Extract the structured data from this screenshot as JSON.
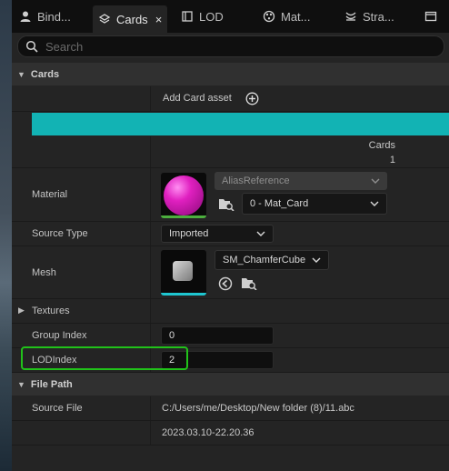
{
  "tabs": [
    {
      "label": "Bind...",
      "icon": "user-icon"
    },
    {
      "label": "Cards",
      "icon": "cards-icon",
      "close": "×"
    },
    {
      "label": "LOD",
      "icon": "lod-icon"
    },
    {
      "label": "Mat...",
      "icon": "material-icon"
    },
    {
      "label": "Stra...",
      "icon": "strand-icon"
    },
    {
      "label": "",
      "icon": "window-icon"
    }
  ],
  "search": {
    "placeholder": "Search"
  },
  "cards_section": {
    "title": "Cards"
  },
  "add_card": {
    "label": "Add Card asset"
  },
  "cards_counter": {
    "label": "Cards",
    "value": "1"
  },
  "material": {
    "label": "Material",
    "alias_reference": "AliasReference",
    "selected": "0 - Mat_Card"
  },
  "source_type": {
    "label": "Source Type",
    "value": "Imported"
  },
  "mesh": {
    "label": "Mesh",
    "value": "SM_ChamferCube"
  },
  "textures": {
    "label": "Textures"
  },
  "group_index": {
    "label": "Group Index",
    "value": "0"
  },
  "lod_index": {
    "label": "LODIndex",
    "value": "2"
  },
  "file_path_section": {
    "title": "File Path"
  },
  "source_file": {
    "label": "Source File",
    "path": "C:/Users/me/Desktop/New folder (8)/11.abc",
    "date": "2023.03.10-22.20.36"
  },
  "colors": {
    "accent": "#12b3b4",
    "highlight": "#21c21a",
    "material_bar": "#4caf3e",
    "mesh_bar": "#1fc6d0",
    "sphere": "#e020c0"
  }
}
